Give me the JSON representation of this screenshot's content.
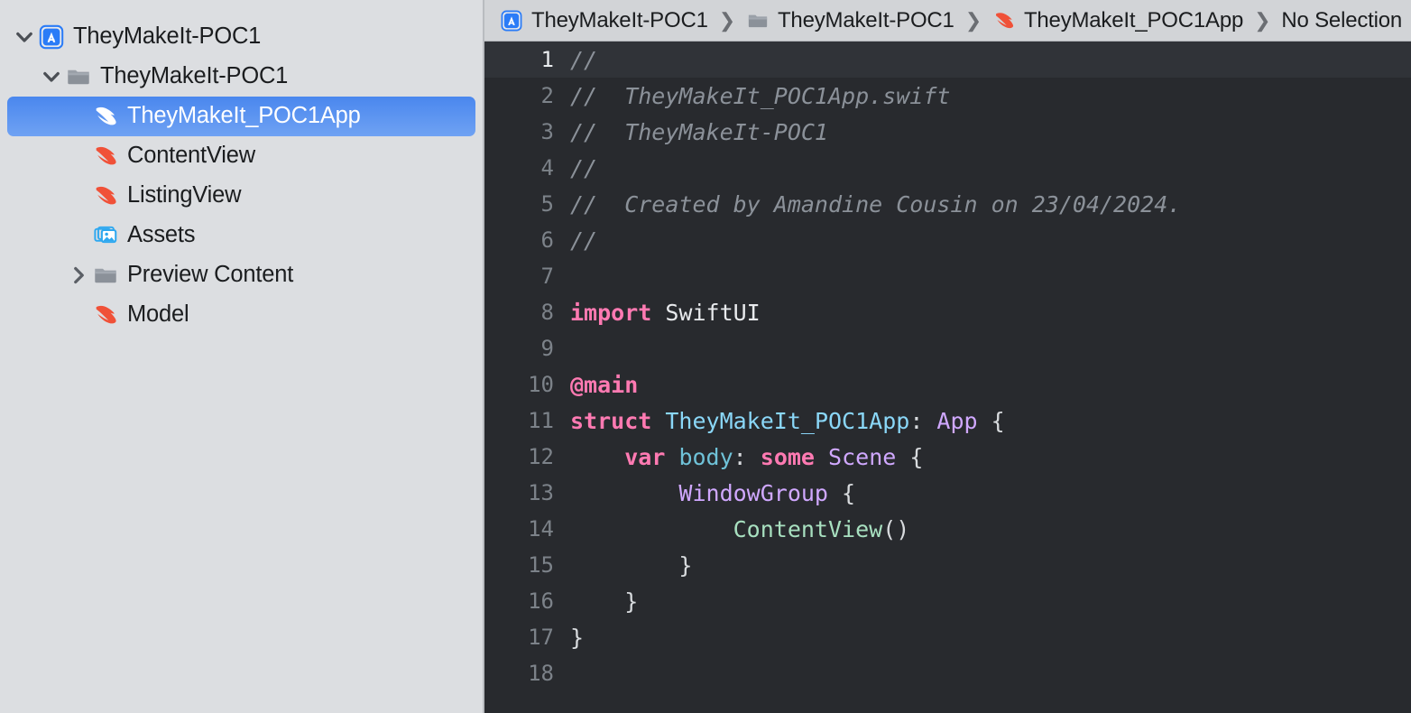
{
  "window": {
    "title": "TheyMakeIt-POC1"
  },
  "navigator": {
    "items": [
      {
        "label": "TheyMakeIt-POC1",
        "icon": "xcode-project-icon",
        "twisty": "chevron-down-icon",
        "depth": 0,
        "selected": false
      },
      {
        "label": "TheyMakeIt-POC1",
        "icon": "folder-icon",
        "twisty": "chevron-down-icon",
        "depth": 1,
        "selected": false
      },
      {
        "label": "TheyMakeIt_POC1App",
        "icon": "swift-file-icon",
        "twisty": "none",
        "depth": 2,
        "selected": true
      },
      {
        "label": "ContentView",
        "icon": "swift-file-icon",
        "twisty": "none",
        "depth": 2,
        "selected": false
      },
      {
        "label": "ListingView",
        "icon": "swift-file-icon",
        "twisty": "none",
        "depth": 2,
        "selected": false
      },
      {
        "label": "Assets",
        "icon": "assets-catalog-icon",
        "twisty": "none",
        "depth": 2,
        "selected": false
      },
      {
        "label": "Preview Content",
        "icon": "folder-icon",
        "twisty": "chevron-right-icon",
        "depth": 2,
        "selected": false
      },
      {
        "label": "Model",
        "icon": "swift-file-icon",
        "twisty": "none",
        "depth": 2,
        "selected": false
      }
    ]
  },
  "jumpbar": {
    "separator": "❯",
    "crumbs": [
      {
        "label": "TheyMakeIt-POC1",
        "icon": "xcode-project-icon"
      },
      {
        "label": "TheyMakeIt-POC1",
        "icon": "folder-icon"
      },
      {
        "label": "TheyMakeIt_POC1App",
        "icon": "swift-file-icon"
      },
      {
        "label": "No Selection",
        "icon": "none"
      }
    ]
  },
  "editor": {
    "filename": "TheyMakeIt_POC1App.swift",
    "current_line": 1,
    "lines": [
      {
        "n": "1",
        "tokens": [
          {
            "t": "//",
            "c": "t-cmt"
          }
        ]
      },
      {
        "n": "2",
        "tokens": [
          {
            "t": "//  TheyMakeIt_POC1App.swift",
            "c": "t-cmt"
          }
        ]
      },
      {
        "n": "3",
        "tokens": [
          {
            "t": "//  TheyMakeIt-POC1",
            "c": "t-cmt"
          }
        ]
      },
      {
        "n": "4",
        "tokens": [
          {
            "t": "//",
            "c": "t-cmt"
          }
        ]
      },
      {
        "n": "5",
        "tokens": [
          {
            "t": "//  Created by Amandine Cousin on 23/04/2024.",
            "c": "t-cmt"
          }
        ]
      },
      {
        "n": "6",
        "tokens": [
          {
            "t": "//",
            "c": "t-cmt"
          }
        ]
      },
      {
        "n": "7",
        "tokens": []
      },
      {
        "n": "8",
        "tokens": [
          {
            "t": "import",
            "c": "t-kw"
          },
          {
            "t": " SwiftUI",
            "c": "t-plain"
          }
        ]
      },
      {
        "n": "9",
        "tokens": []
      },
      {
        "n": "10",
        "tokens": [
          {
            "t": "@main",
            "c": "t-kw"
          }
        ]
      },
      {
        "n": "11",
        "tokens": [
          {
            "t": "struct",
            "c": "t-kw"
          },
          {
            "t": " ",
            "c": "t-plain"
          },
          {
            "t": "TheyMakeIt_POC1App",
            "c": "t-type"
          },
          {
            "t": ": ",
            "c": "t-punc"
          },
          {
            "t": "App",
            "c": "t-type2"
          },
          {
            "t": " {",
            "c": "t-punc"
          }
        ]
      },
      {
        "n": "12",
        "tokens": [
          {
            "t": "    ",
            "c": "t-plain"
          },
          {
            "t": "var",
            "c": "t-kw"
          },
          {
            "t": " ",
            "c": "t-plain"
          },
          {
            "t": "body",
            "c": "t-prop"
          },
          {
            "t": ": ",
            "c": "t-punc"
          },
          {
            "t": "some",
            "c": "t-kw"
          },
          {
            "t": " ",
            "c": "t-plain"
          },
          {
            "t": "Scene",
            "c": "t-type2"
          },
          {
            "t": " {",
            "c": "t-punc"
          }
        ]
      },
      {
        "n": "13",
        "tokens": [
          {
            "t": "        ",
            "c": "t-plain"
          },
          {
            "t": "WindowGroup",
            "c": "t-type2"
          },
          {
            "t": " {",
            "c": "t-punc"
          }
        ]
      },
      {
        "n": "14",
        "tokens": [
          {
            "t": "            ",
            "c": "t-plain"
          },
          {
            "t": "ContentView",
            "c": "t-call"
          },
          {
            "t": "()",
            "c": "t-punc"
          }
        ]
      },
      {
        "n": "15",
        "tokens": [
          {
            "t": "        }",
            "c": "t-punc"
          }
        ]
      },
      {
        "n": "16",
        "tokens": [
          {
            "t": "    }",
            "c": "t-punc"
          }
        ]
      },
      {
        "n": "17",
        "tokens": [
          {
            "t": "}",
            "c": "t-punc"
          }
        ]
      },
      {
        "n": "18",
        "tokens": []
      }
    ]
  },
  "colors": {
    "sidebar_bg": "#dcdee1",
    "selection_blue": "#4a87ee",
    "editor_bg": "#282a2e",
    "current_line_bg": "#303338",
    "jumpbar_bg": "#d2d4d7",
    "swift_orange": "#f05138",
    "comment_grey": "#8b9199",
    "keyword_pink": "#ff7ab2",
    "type_cyan": "#8ad7f8",
    "type_purple": "#d0a8ff",
    "call_mint": "#a8e0c0"
  }
}
